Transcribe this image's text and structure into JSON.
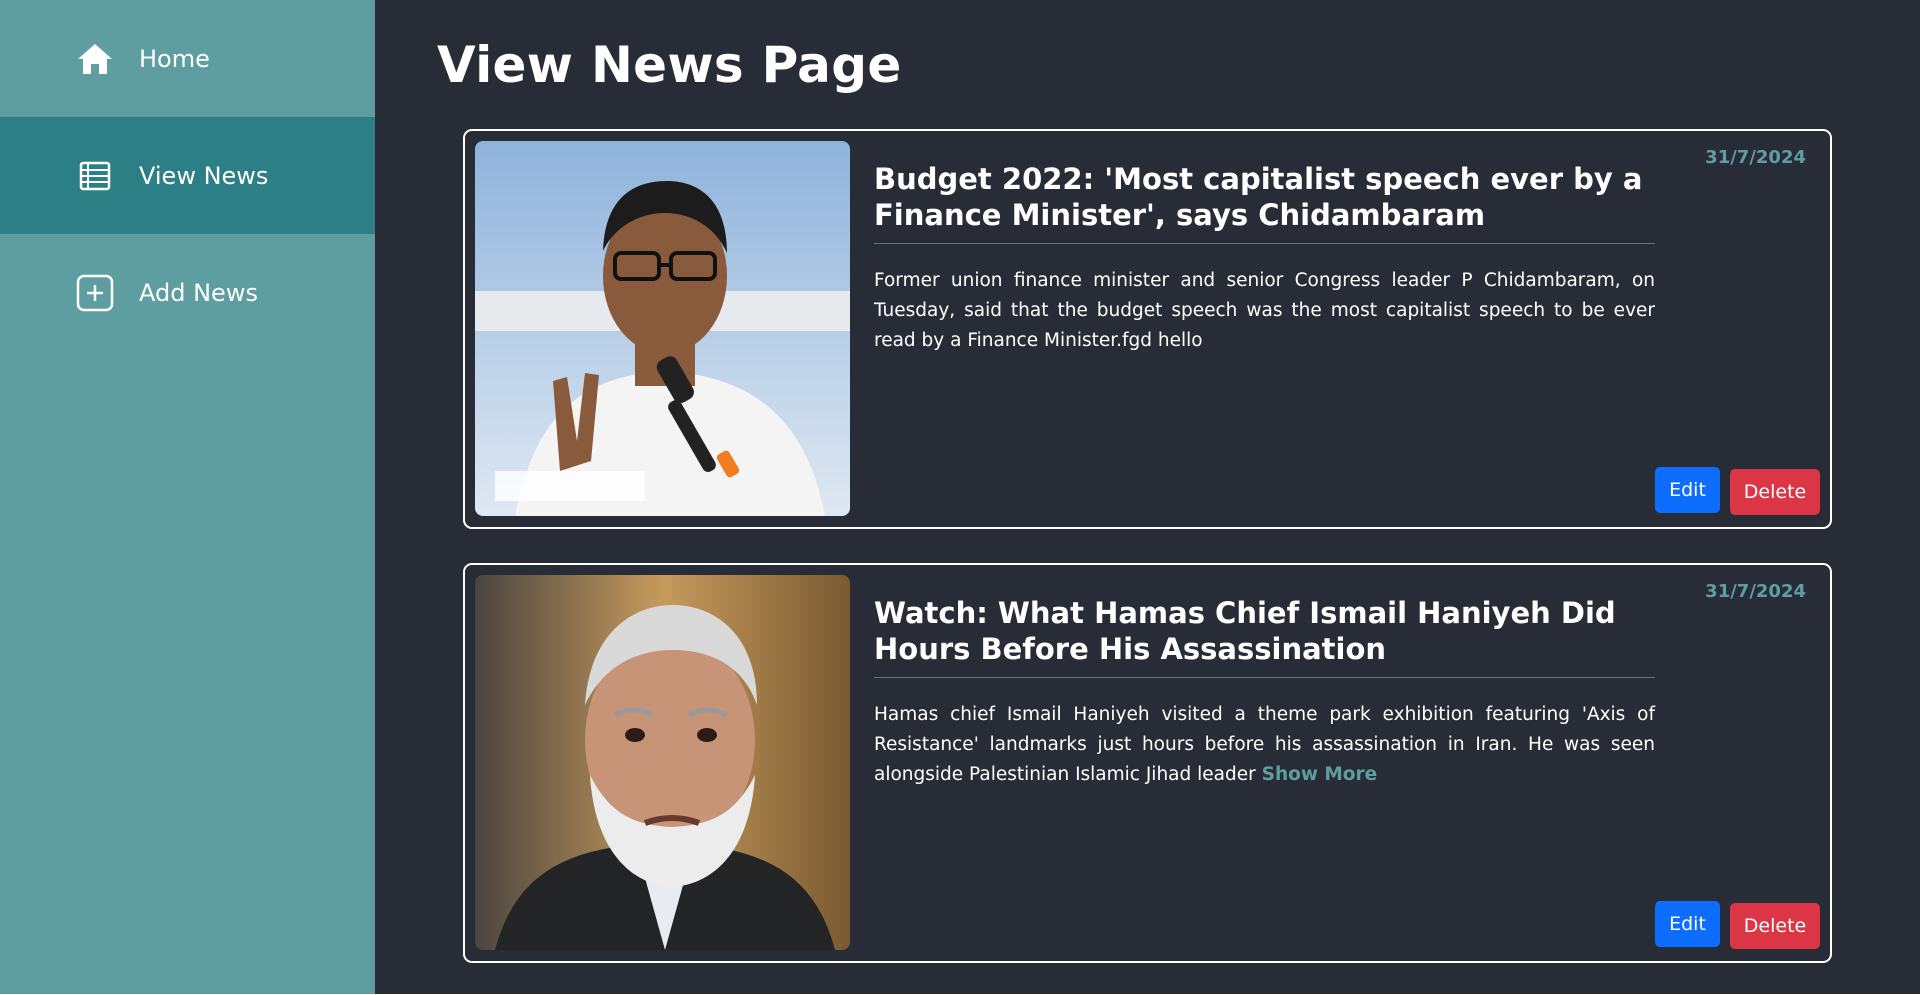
{
  "sidebar": {
    "items": [
      {
        "label": "Home",
        "icon": "home-icon",
        "active": false
      },
      {
        "label": "View News",
        "icon": "list-icon",
        "active": true
      },
      {
        "label": "Add News",
        "icon": "plus-square-icon",
        "active": false
      }
    ]
  },
  "page": {
    "title": "View News Page"
  },
  "news": [
    {
      "date": "31/7/2024",
      "title": "Budget 2022: 'Most capitalist speech ever by a Finance Minister', says Chidambaram",
      "description": "Former union finance minister and senior Congress leader P Chidambaram, on Tuesday, said that the budget speech was the most capitalist speech to be ever read by a Finance Minister.fgd hello",
      "show_more": "",
      "edit_label": "Edit",
      "delete_label": "Delete"
    },
    {
      "date": "31/7/2024",
      "title": "Watch: What Hamas Chief Ismail Haniyeh Did Hours Before His Assassination",
      "description": "Hamas chief Ismail Haniyeh visited a theme park exhibition featuring 'Axis of Resistance' landmarks just hours before his assassination in Iran. He was seen alongside Palestinian Islamic Jihad leader",
      "show_more": "Show More",
      "edit_label": "Edit",
      "delete_label": "Delete"
    }
  ],
  "colors": {
    "sidebar": "#5f9ea0",
    "sidebar_active": "#2c7f84",
    "main_bg": "#282c37",
    "accent": "#5f9ea0",
    "edit": "#0d6efd",
    "delete": "#dc3545"
  }
}
